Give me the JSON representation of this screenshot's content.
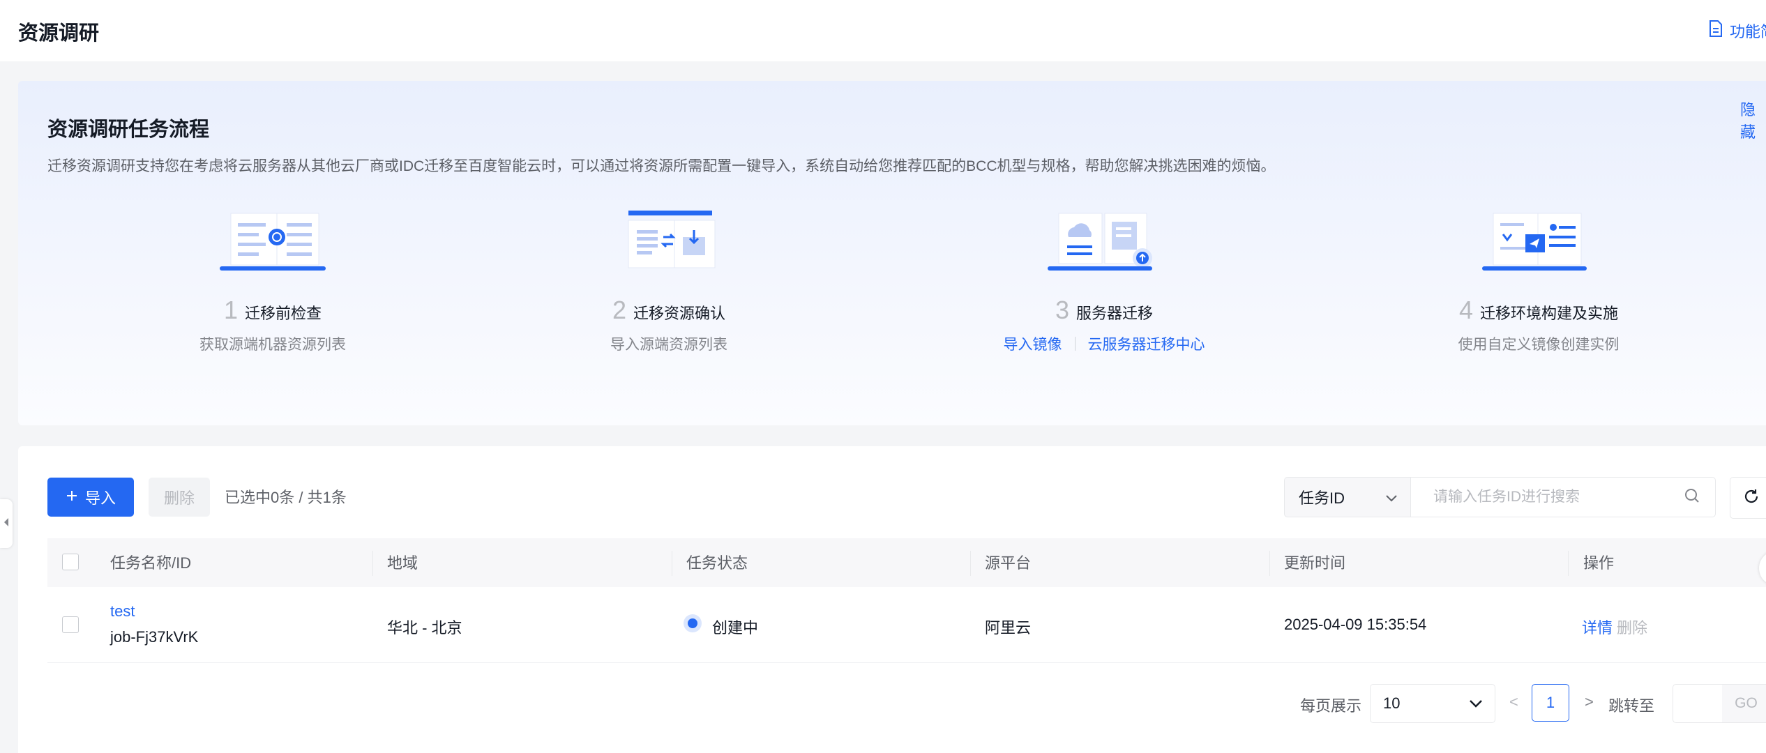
{
  "header": {
    "title": "资源调研",
    "doc_link": "功能简"
  },
  "process": {
    "hide_label": "隐藏",
    "title": "资源调研任务流程",
    "description": "迁移资源调研支持您在考虑将云服务器从其他云厂商或IDC迁移至百度智能云时，可以通过将资源所需配置一键导入，系统自动给您推荐匹配的BCC机型与规格，帮助您解决挑选困难的烦恼。",
    "steps": [
      {
        "num": "1",
        "name": "迁移前检查",
        "sub": "获取源端机器资源列表"
      },
      {
        "num": "2",
        "name": "迁移资源确认",
        "sub": "导入源端资源列表"
      },
      {
        "num": "3",
        "name": "服务器迁移",
        "links": [
          "导入镜像",
          "云服务器迁移中心"
        ]
      },
      {
        "num": "4",
        "name": "迁移环境构建及实施",
        "sub": "使用自定义镜像创建实例"
      }
    ]
  },
  "toolbar": {
    "import_label": "导入",
    "delete_label": "删除",
    "selection_text": "已选中0条 / 共1条",
    "search_field": "任务ID",
    "search_placeholder": "请输入任务ID进行搜索"
  },
  "table": {
    "columns": [
      "任务名称/ID",
      "地域",
      "任务状态",
      "源平台",
      "更新时间",
      "操作"
    ],
    "rows": [
      {
        "name": "test",
        "id": "job-Fj37kVrK",
        "region": "华北 - 北京",
        "status": "创建中",
        "platform": "阿里云",
        "updated": "2025-04-09 15:35:54",
        "actions": [
          "详情",
          "删除"
        ]
      }
    ]
  },
  "pagination": {
    "per_page_label": "每页展示",
    "page_size": "10",
    "prev": "<",
    "current_page": "1",
    "next": ">",
    "jump_label": "跳转至",
    "go_label": "GO"
  },
  "colors": {
    "accent": "#2468f2",
    "background": "#f4f5f7",
    "card_gradient_top": "#e9effd"
  },
  "icons": [
    "doc-icon",
    "plus-icon",
    "chevron-down-icon",
    "search-icon",
    "refresh-icon",
    "collapse-arrow-icon"
  ]
}
